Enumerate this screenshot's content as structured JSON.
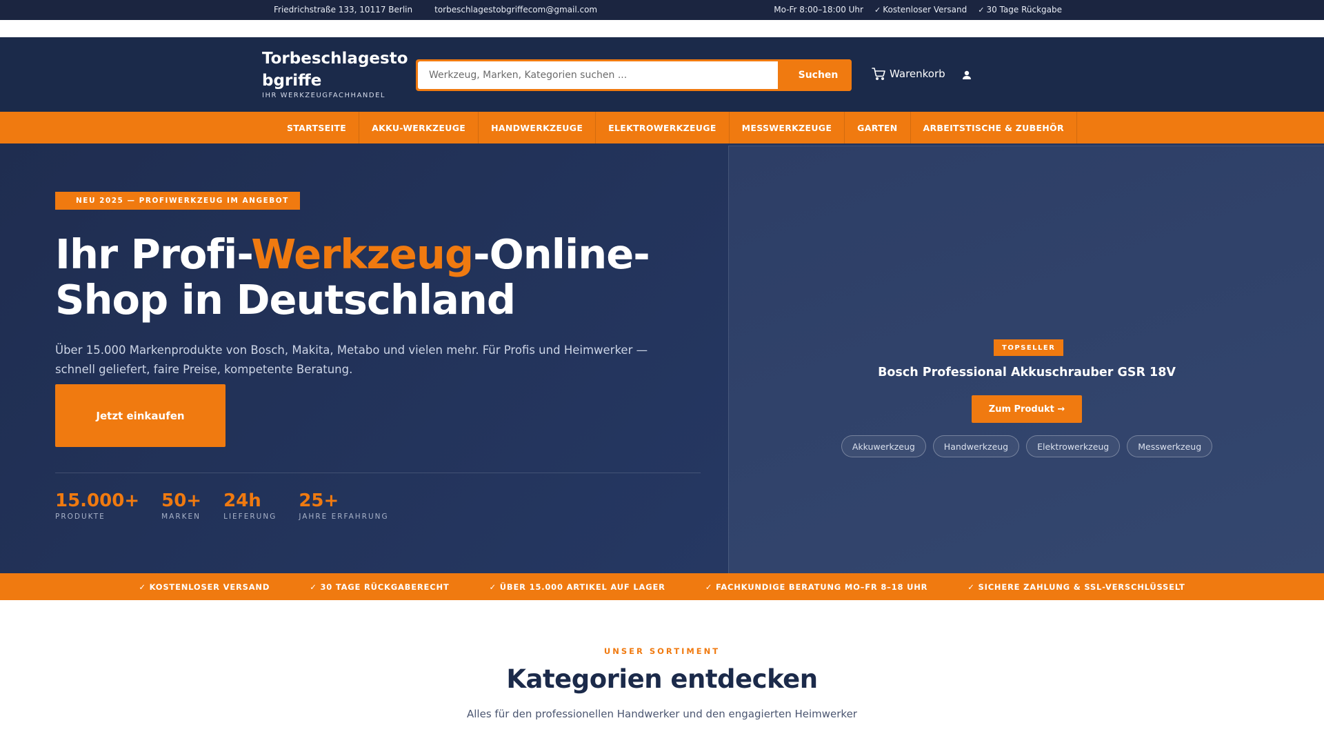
{
  "topbar": {
    "address": "Friedrichstraße 133, 10117 Berlin",
    "email": "torbeschlagestobgriffecom@gmail.com",
    "hours": "Mo-Fr 8:00–18:00 Uhr",
    "shipping": "Kostenloser Versand",
    "returns": "30 Tage Rückgabe",
    "check_icon": "check-icon"
  },
  "header": {
    "logo_title": "Torbeschlagestobgriffe",
    "logo_subtitle": "IHR WERKZEUGFACHHANDEL",
    "search_placeholder": "Werkzeug, Marken, Kategorien suchen ...",
    "search_button": "Suchen",
    "cart_label": "Warenkorb",
    "cart_icon": "cart-icon",
    "user_icon": "user-icon"
  },
  "nav": {
    "items": [
      {
        "label": "STARTSEITE"
      },
      {
        "label": "AKKU-WERKZEUGE"
      },
      {
        "label": "HANDWERKZEUGE"
      },
      {
        "label": "ELEKTROWERKZEUGE"
      },
      {
        "label": "MESSWERKZEUGE"
      },
      {
        "label": "GARTEN"
      },
      {
        "label": "ARBEITSTISCHE & ZUBEHÖR"
      }
    ]
  },
  "hero": {
    "badge": "NEU 2025 — PROFIWERKZEUG IM ANGEBOT",
    "title_part1": "Ihr Profi-",
    "title_accent": "Werkzeug",
    "title_part2": "-Online-Shop in Deutschland",
    "description": "Über 15.000 Markenprodukte von Bosch, Makita, Metabo und vielen mehr. Für Profis und Heimwerker — schnell geliefert, faire Preise, kompetente Beratung.",
    "cta": "Jetzt einkaufen",
    "stats": [
      {
        "value": "15.000+",
        "label": "PRODUKTE"
      },
      {
        "value": "50+",
        "label": "MARKEN"
      },
      {
        "value": "24h",
        "label": "LIEFERUNG"
      },
      {
        "value": "25+",
        "label": "JAHRE ERFAHRUNG"
      }
    ],
    "panel": {
      "badge": "TOPSELLER",
      "product_name": "Bosch Professional Akkuschrauber GSR 18V",
      "button": "Zum Produkt →",
      "tags": [
        "Akkuwerkzeug",
        "Handwerkzeug",
        "Elektrowerkzeug",
        "Messwerkzeug"
      ]
    }
  },
  "trustbar": {
    "items": [
      "✓ KOSTENLOSER VERSAND",
      "✓ 30 TAGE RÜCKGABERECHT",
      "✓ ÜBER 15.000 ARTIKEL AUF LAGER",
      "✓ FACHKUNDIGE BERATUNG MO–FR 8–18 UHR",
      "✓ SICHERE ZAHLUNG & SSL-VERSCHLÜSSELT"
    ]
  },
  "section": {
    "eyebrow": "UNSER SORTIMENT",
    "title": "Kategorien entdecken",
    "description": "Alles für den professionellen Handwerker und den engagierten Heimwerker"
  },
  "colors": {
    "navy": "#1b2a4a",
    "topbar": "#1b2540",
    "accent": "#f07a10",
    "hero_bg": "#253761"
  }
}
